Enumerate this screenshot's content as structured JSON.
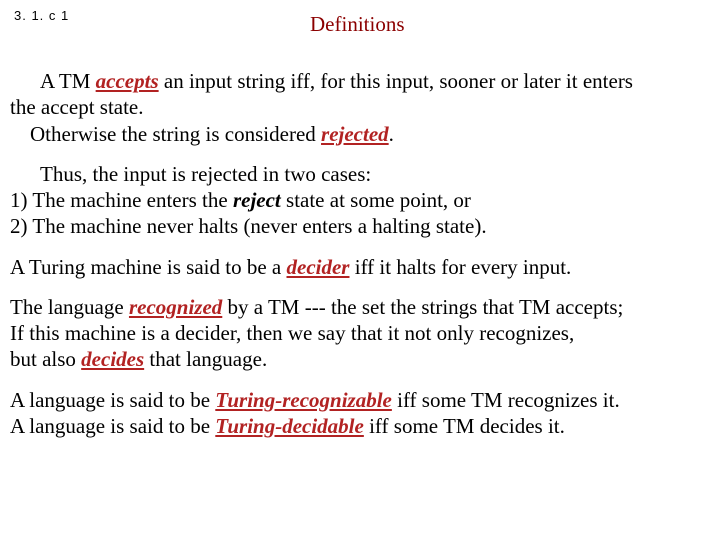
{
  "header": {
    "slide_num": "3. 1. c 1",
    "title": "Definitions"
  },
  "p1": {
    "a": "A TM ",
    "accepts": "accepts",
    "b": " an input string iff, for this input, sooner or later it enters",
    "c": "the accept state.",
    "d": "Otherwise the string is considered ",
    "rejected": "rejected",
    "dot1": "."
  },
  "p2": {
    "a": "Thus, the input is rejected in two cases:",
    "l1a": "1)   The machine enters the ",
    "reject": "reject",
    "l1b": " state at some point, or",
    "l2": "2)   The machine never halts (never enters a halting state)."
  },
  "p3": {
    "a": "A Turing machine is said to be a ",
    "decider": "decider",
    "b": " iff it halts for every input."
  },
  "p4": {
    "a": "The language ",
    "recognized": "recognized",
    "b": " by a TM --- the set the strings that TM accepts;",
    "c": "If this machine is a decider, then we say that it not only recognizes,",
    "d": "but also ",
    "decides": "decides",
    "e": " that language."
  },
  "p5": {
    "a": "A language is said to be ",
    "tr": "Turing-recognizable",
    "b": " iff some TM recognizes it.",
    "c": "A language is said to be ",
    "td": "Turing-decidable",
    "d": " iff some TM decides it."
  }
}
